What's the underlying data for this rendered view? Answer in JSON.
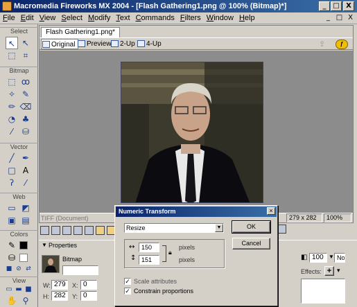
{
  "window": {
    "title": "Macromedia Fireworks MX 2004 - [Flash Gathering1.png @ 100% (Bitmap)*]",
    "minimize": "_",
    "restore": "□",
    "close": "X"
  },
  "menu": [
    "File",
    "Edit",
    "View",
    "Select",
    "Modify",
    "Text",
    "Commands",
    "Filters",
    "Window",
    "Help"
  ],
  "mdi": {
    "minimize": "_",
    "restore": "□",
    "close": "X"
  },
  "tools": {
    "sections": [
      "Select",
      "Bitmap",
      "Vector",
      "Web",
      "Colors",
      "View"
    ]
  },
  "document": {
    "tab": "Flash Gathering1.png*",
    "views": [
      "Original",
      "Preview",
      "2-Up",
      "4-Up"
    ],
    "status_left": "TIFF (Document)",
    "size": "279 x 282",
    "zoom": "100%"
  },
  "properties": {
    "header": "Properties",
    "type": "Bitmap",
    "w_label": "W:",
    "w": "279",
    "h_label": "H:",
    "h": "282",
    "x_label": "X:",
    "x": "0",
    "y_label": "Y:",
    "y": "0",
    "opacity": "100",
    "blend": "Nor",
    "effects_label": "Effects:",
    "effects_add": "+"
  },
  "dialog": {
    "title": "Numeric Transform",
    "mode": "Resize",
    "width": "150",
    "height": "151",
    "unit_w": "pixels",
    "unit_h": "pixels",
    "scale_attributes": "Scale attributes",
    "constrain": "Constrain proportions",
    "ok": "OK",
    "cancel": "Cancel"
  },
  "colors": {
    "titlebar": "#0a246a",
    "canvas": "#8c8c8c",
    "chrome": "#d4d0c8"
  }
}
